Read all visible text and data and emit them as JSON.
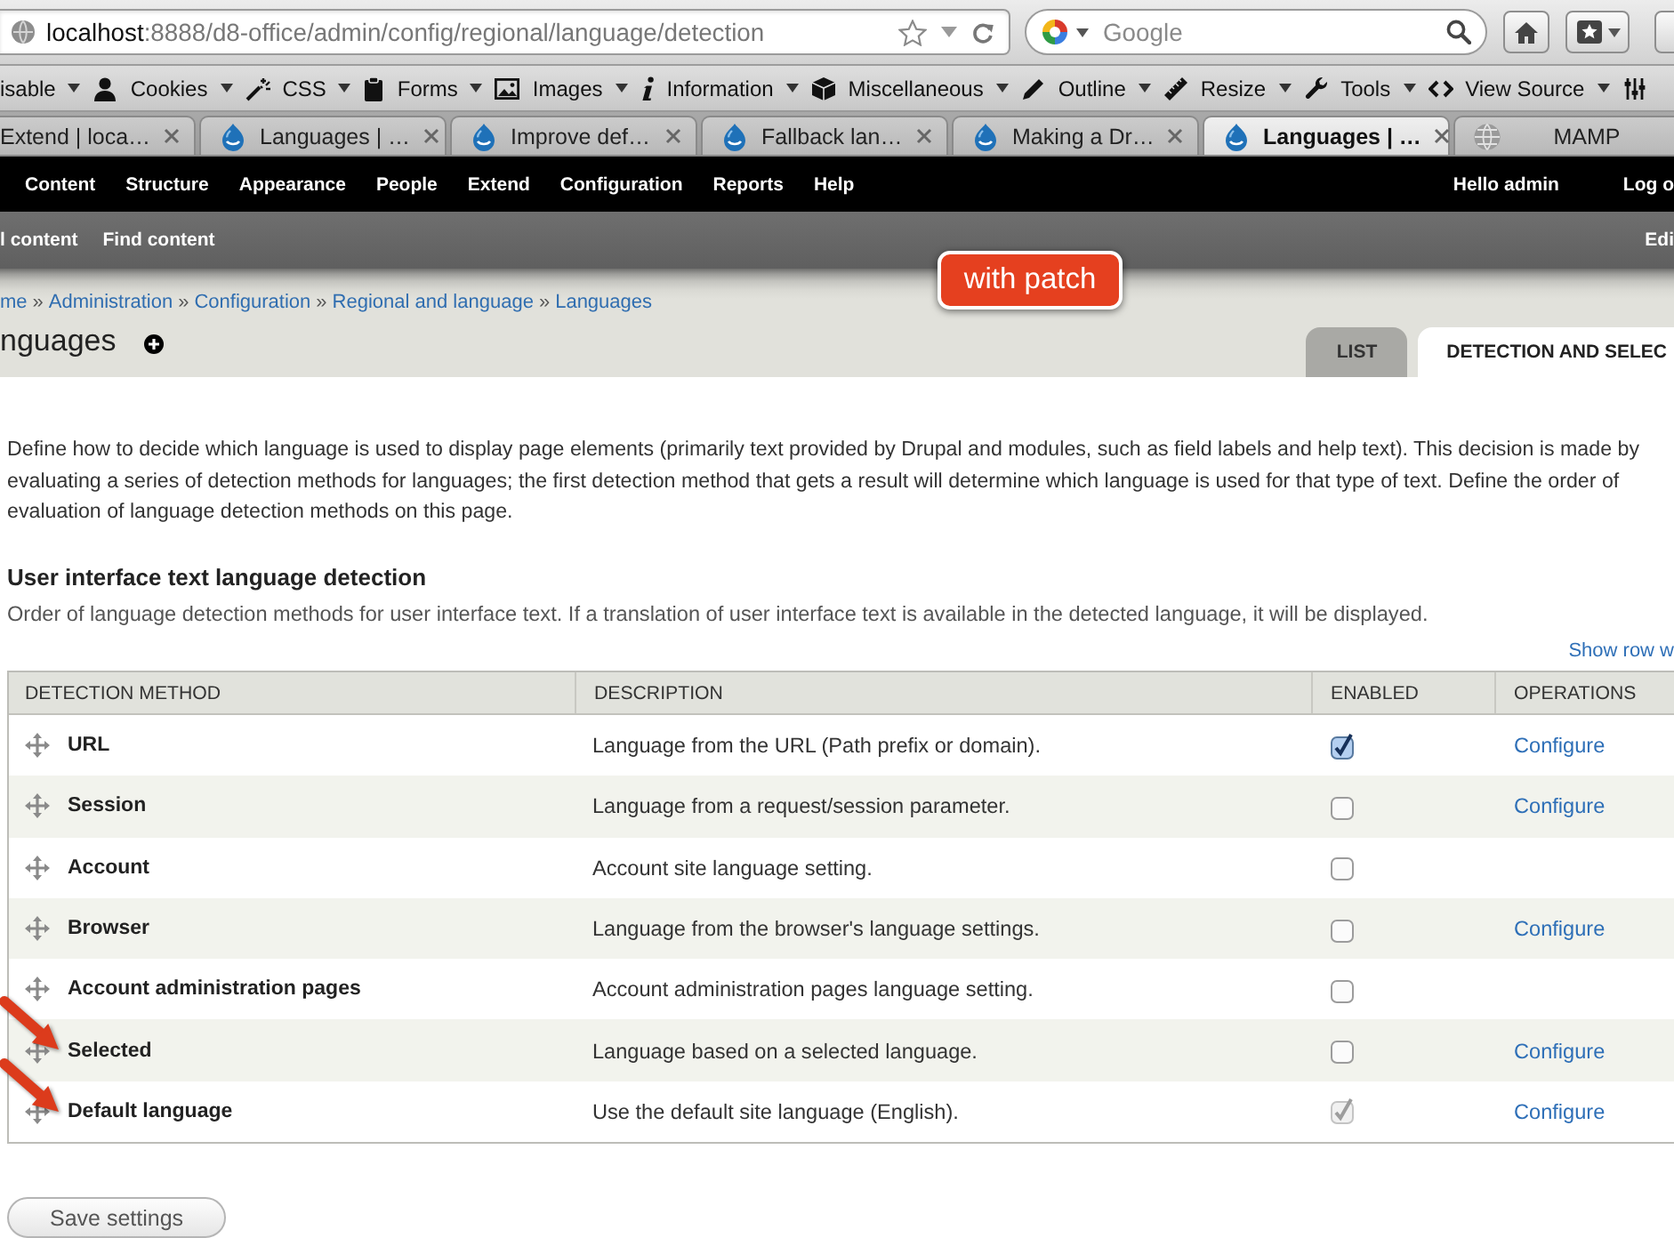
{
  "browser": {
    "url": {
      "host": "localhost",
      "path": ":8888/d8-office/admin/config/regional/language/detection"
    },
    "search": {
      "placeholder": "Google"
    }
  },
  "dev_toolbar": [
    "isable",
    "Cookies",
    "CSS",
    "Forms",
    "Images",
    "Information",
    "Miscellaneous",
    "Outline",
    "Resize",
    "Tools",
    "View Source"
  ],
  "browser_tabs": [
    {
      "title": "Extend | loca…",
      "selected": false
    },
    {
      "title": "Languages | …",
      "selected": false
    },
    {
      "title": "Improve def…",
      "selected": false
    },
    {
      "title": "Fallback lan…",
      "selected": false
    },
    {
      "title": "Making a Dr…",
      "selected": false
    },
    {
      "title": "Languages | …",
      "selected": true
    },
    {
      "title": "MAMP",
      "selected": false
    }
  ],
  "admin_toolbar": {
    "menu": [
      "Content",
      "Structure",
      "Appearance",
      "People",
      "Extend",
      "Configuration",
      "Reports",
      "Help"
    ],
    "greeting": "Hello admin",
    "logout": "Log o"
  },
  "shortcuts": {
    "items": [
      "l content",
      "Find content"
    ],
    "edit": "Edi"
  },
  "page_header": {
    "breadcrumb": [
      {
        "kind": "link",
        "text": "me"
      },
      {
        "kind": "separator",
        "text": "»"
      },
      {
        "kind": "link",
        "text": "Administration"
      },
      {
        "kind": "separator",
        "text": "»"
      },
      {
        "kind": "link",
        "text": "Configuration"
      },
      {
        "kind": "separator",
        "text": "»"
      },
      {
        "kind": "link",
        "text": "Regional and language"
      },
      {
        "kind": "separator",
        "text": "»"
      },
      {
        "kind": "link",
        "text": "Languages"
      }
    ],
    "title": "nguages",
    "callout": "with patch",
    "tabs": [
      {
        "label": "LIST",
        "selected": false
      },
      {
        "label": "DETECTION AND SELEC",
        "selected": true
      }
    ]
  },
  "description": {
    "lines": [
      "Define how to decide which language is used to display page elements (primarily text provided by Drupal and modules, such as field labels and help text). This decision is made by",
      "evaluating a series of detection methods for languages; the first detection method that gets a result will determine which language is used for that type of text. Define the order of",
      "evaluation of language detection methods on this page."
    ]
  },
  "section": {
    "title": "User interface text language detection",
    "help": "Order of language detection methods for user interface text. If a translation of user interface text is available in the detected language, it will be displayed.",
    "show_weights": "Show row w"
  },
  "table": {
    "columns": [
      "DETECTION METHOD",
      "DESCRIPTION",
      "ENABLED",
      "OPERATIONS"
    ],
    "rows": [
      {
        "method": "URL",
        "description": "Language from the URL (Path prefix or domain).",
        "enabled": true,
        "disabled": false,
        "operation": "Configure",
        "arrow": false
      },
      {
        "method": "Session",
        "description": "Language from a request/session parameter.",
        "enabled": false,
        "disabled": false,
        "operation": "Configure",
        "arrow": false
      },
      {
        "method": "Account",
        "description": "Account site language setting.",
        "enabled": false,
        "disabled": false,
        "arrow": false
      },
      {
        "method": "Browser",
        "description": "Language from the browser's language settings.",
        "enabled": false,
        "disabled": false,
        "operation": "Configure",
        "arrow": false
      },
      {
        "method": "Account administration pages",
        "description": "Account administration pages language setting.",
        "enabled": false,
        "disabled": false,
        "arrow": false
      },
      {
        "method": "Selected",
        "description": "Language based on a selected language.",
        "enabled": false,
        "disabled": false,
        "operation": "Configure",
        "arrow": true
      },
      {
        "method": "Default language",
        "description": "Use the default site language (English).",
        "enabled": true,
        "disabled": true,
        "operation": "Configure",
        "arrow": true
      }
    ]
  },
  "actions": {
    "save": "Save settings"
  }
}
